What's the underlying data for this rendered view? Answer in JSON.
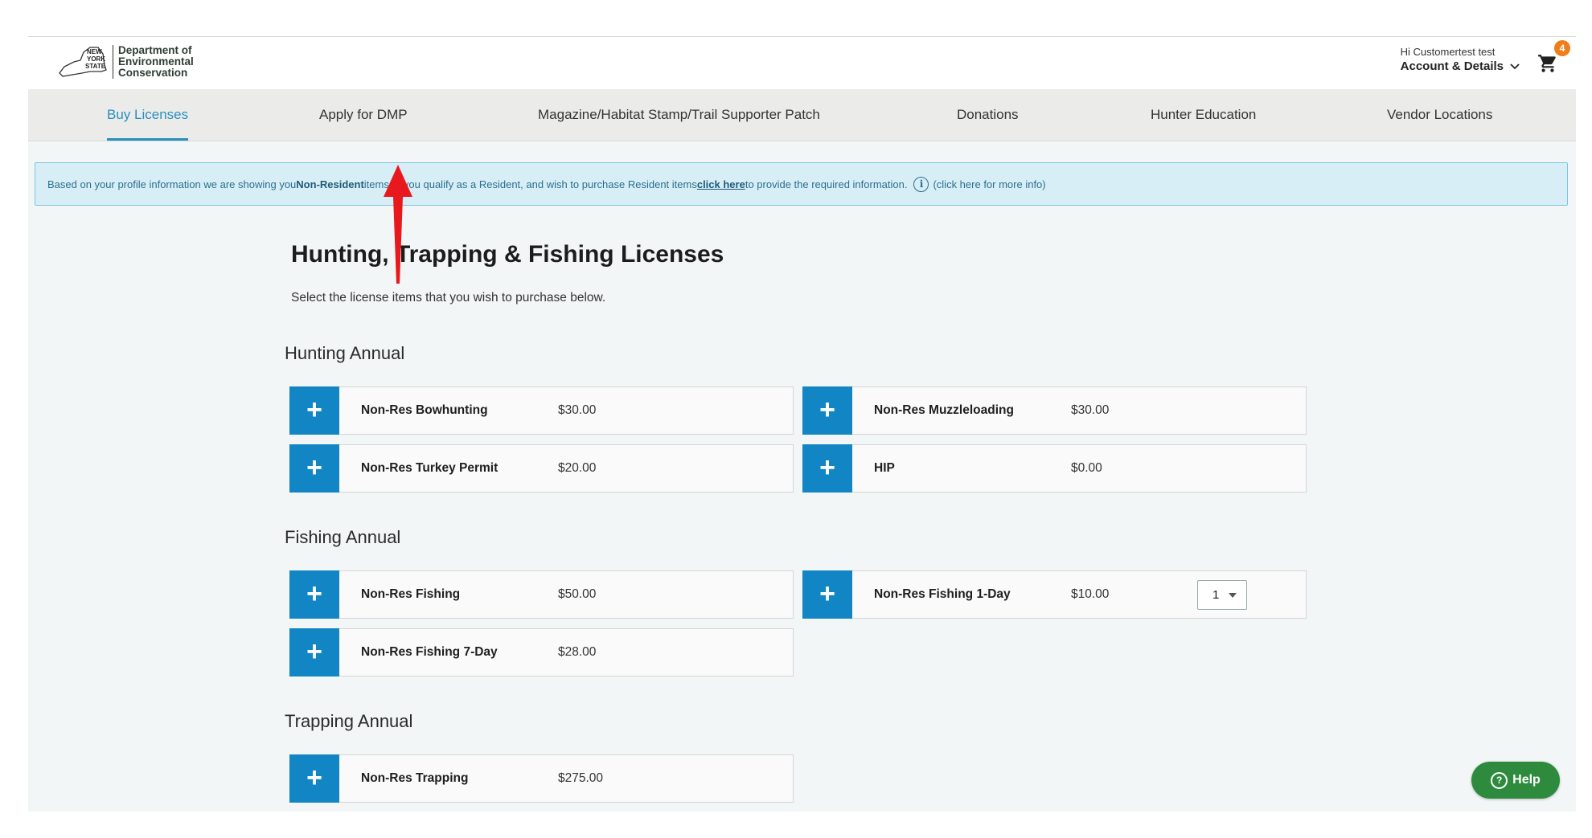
{
  "header": {
    "logo": {
      "state_lines": [
        "NEW",
        "YORK",
        "STATE"
      ],
      "org_lines": [
        "Department of",
        "Environmental",
        "Conservation"
      ]
    },
    "greeting": "Hi Customertest test",
    "account_label": "Account & Details",
    "cart_count": "4"
  },
  "nav": {
    "items": [
      {
        "label": "Buy Licenses"
      },
      {
        "label": "Apply for DMP"
      },
      {
        "label": "Magazine/Habitat Stamp/Trail Supporter Patch"
      },
      {
        "label": "Donations"
      },
      {
        "label": "Hunter Education"
      },
      {
        "label": "Vendor Locations"
      }
    ]
  },
  "alert": {
    "prefix": "Based on your profile information we are showing you ",
    "highlight": "Non-Resident",
    "middle": " items. If you qualify as a Resident, and wish to purchase Resident items ",
    "link": "click here",
    "suffix": " to provide the required information.",
    "info_icon": "i",
    "more_info": "(click here for more info)"
  },
  "main": {
    "title": "Hunting, Trapping & Fishing Licenses",
    "subtitle": "Select the license items that you wish to purchase below.",
    "sections": [
      {
        "title": "Hunting Annual",
        "items": [
          {
            "name": "Non-Res Bowhunting",
            "price": "$30.00"
          },
          {
            "name": "Non-Res Muzzleloading",
            "price": "$30.00"
          },
          {
            "name": "Non-Res Turkey Permit",
            "price": "$20.00"
          },
          {
            "name": "HIP",
            "price": "$0.00"
          }
        ]
      },
      {
        "title": "Fishing Annual",
        "items": [
          {
            "name": "Non-Res Fishing",
            "price": "$50.00"
          },
          {
            "name": "Non-Res Fishing 1-Day",
            "price": "$10.00",
            "quantity": "1"
          },
          {
            "name": "Non-Res Fishing 7-Day",
            "price": "$28.00"
          }
        ]
      },
      {
        "title": "Trapping Annual",
        "items": [
          {
            "name": "Non-Res Trapping",
            "price": "$275.00"
          }
        ]
      }
    ],
    "add_symbol": "+"
  },
  "help": {
    "label": "Help",
    "icon": "?"
  },
  "colors": {
    "accent": "#1286c5",
    "nav_active": "#2a8fbd",
    "alert_bg": "#d8eef6",
    "help_green": "#2e8b3e",
    "badge_orange": "#f07d1a",
    "annotation_arrow": "#e8191e"
  }
}
